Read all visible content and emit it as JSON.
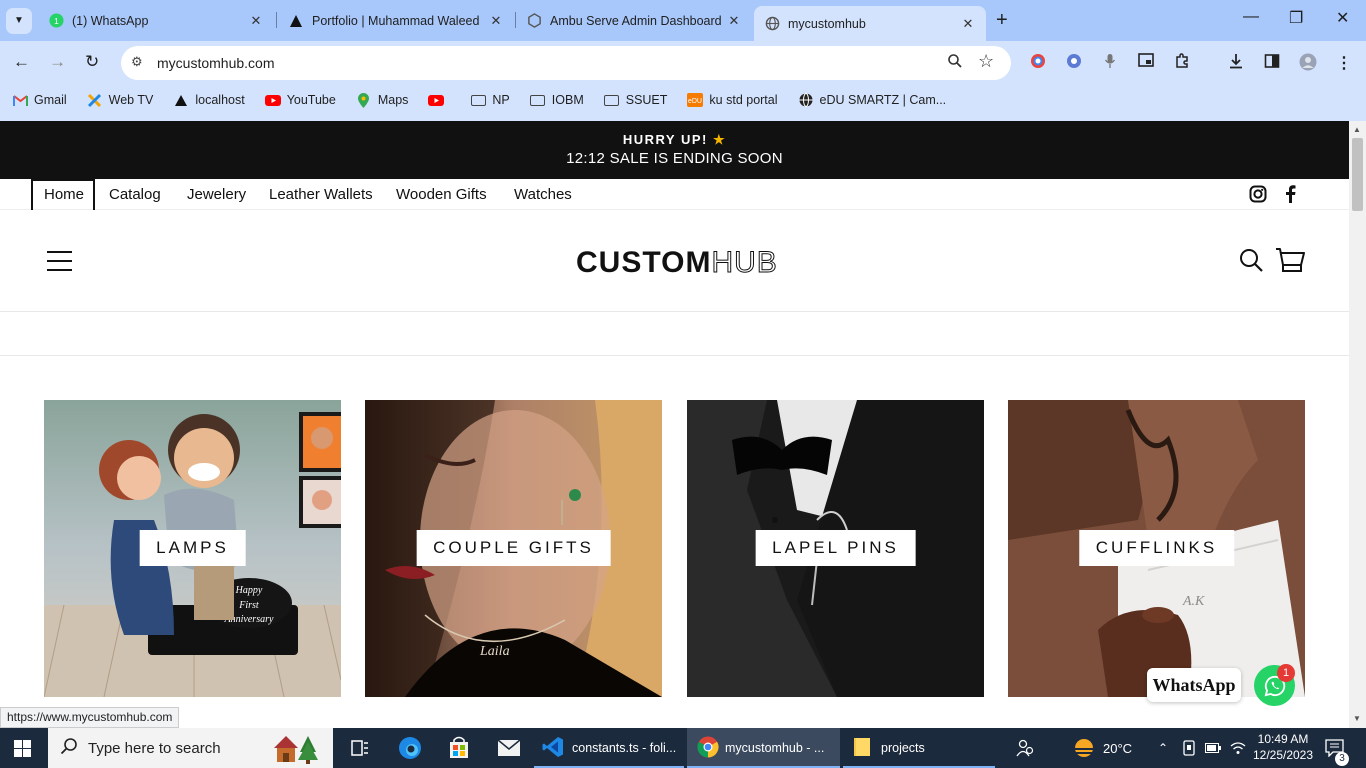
{
  "browser": {
    "tabs": [
      {
        "title": "(1) WhatsApp",
        "icon": "whatsapp-icon"
      },
      {
        "title": "Portfolio | Muhammad Waleed",
        "icon": "triangle-icon"
      },
      {
        "title": "Ambu Serve Admin Dashboard",
        "icon": "hexagon-icon"
      },
      {
        "title": "mycustomhub",
        "icon": "globe-icon",
        "active": true
      }
    ],
    "url": "mycustomhub.com",
    "bookmarks": [
      {
        "label": "Gmail",
        "icon": "gmail-icon"
      },
      {
        "label": "Web TV",
        "icon": "webtv-icon"
      },
      {
        "label": "localhost",
        "icon": "triangle-icon"
      },
      {
        "label": "YouTube",
        "icon": "youtube-icon"
      },
      {
        "label": "Maps",
        "icon": "maps-icon"
      },
      {
        "label": "",
        "icon": "youtube-icon"
      },
      {
        "label": "NP",
        "icon": "folder-icon"
      },
      {
        "label": "IOBM",
        "icon": "folder-icon"
      },
      {
        "label": "SSUET",
        "icon": "folder-icon"
      },
      {
        "label": "ku std portal",
        "icon": "edu-icon"
      },
      {
        "label": "eDU SMARTZ | Cam...",
        "icon": "globe-icon"
      }
    ],
    "status_url": "https://www.mycustomhub.com"
  },
  "site": {
    "announcement": {
      "line1": "HURRY UP!",
      "star": "★",
      "line2": "12:12 SALE IS ENDING SOON"
    },
    "nav": [
      "Home",
      "Catalog",
      "Jewelery",
      "Leather Wallets",
      "Wooden Gifts",
      "Watches"
    ],
    "logo": {
      "custom": "CUSTOM",
      "hub": "HUB"
    },
    "collections": [
      {
        "label": "LAMPS"
      },
      {
        "label": "COUPLE GIFTS"
      },
      {
        "label": "LAPEL PINS"
      },
      {
        "label": "CUFFLINKS"
      }
    ],
    "whatsapp": {
      "label": "WhatsApp",
      "badge": "1"
    }
  },
  "taskbar": {
    "search_placeholder": "Type here to search",
    "items": [
      {
        "label": "constants.ts - foli..."
      },
      {
        "label": "mycustomhub - ..."
      },
      {
        "label": "projects"
      }
    ],
    "weather": "20°C",
    "time": "10:49 AM",
    "date": "12/25/2023",
    "notifications": "3"
  },
  "colors": {
    "chrome": "#a8c7fa",
    "toolbar": "#d3e3fd",
    "announce_bg": "#111111",
    "whatsapp": "#25d366",
    "taskbar": "#1c2a3d"
  }
}
